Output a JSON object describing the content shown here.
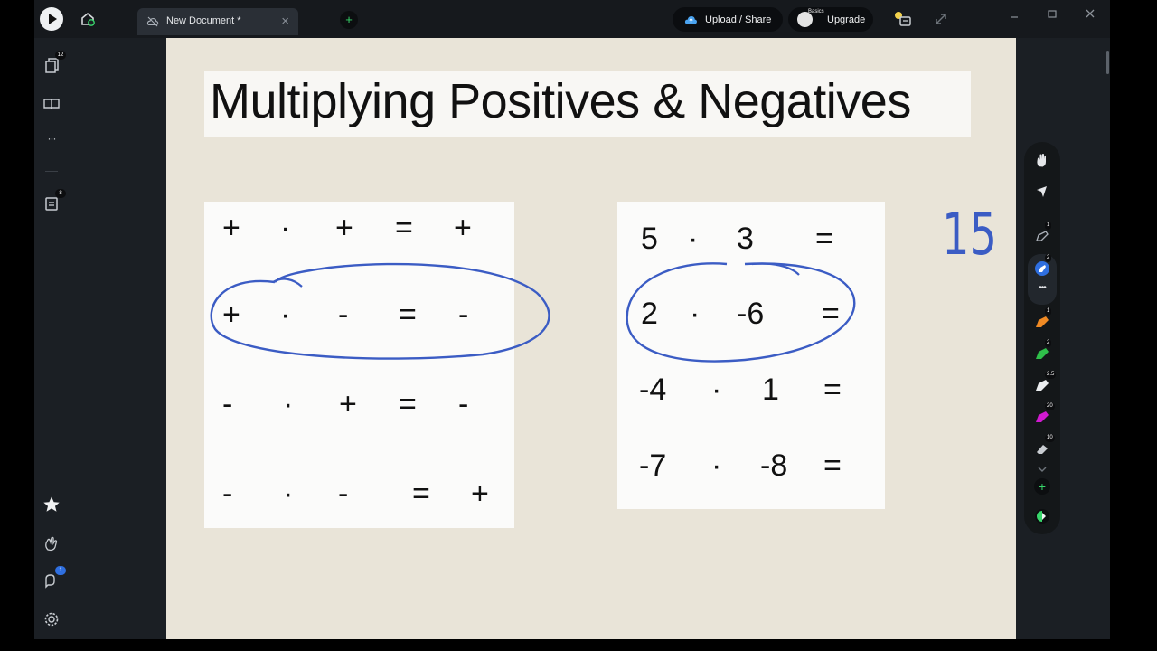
{
  "tab": {
    "title": "New Document *",
    "close_glyph": "×"
  },
  "new_tab_glyph": "+",
  "upload": {
    "label": "Upload / Share"
  },
  "upgrade": {
    "badge": "Basics",
    "label": "Upgrade"
  },
  "sidebar": {
    "pages_badge": "12",
    "more_glyph": "···",
    "notes_badge": "8",
    "help_badge": "1"
  },
  "canvas": {
    "title": "Multiplying Positives & Negatives",
    "sign_rules": [
      [
        "+",
        "·",
        "+",
        "=",
        "+"
      ],
      [
        "+",
        "·",
        "-",
        "=",
        "-"
      ],
      [
        "-",
        "·",
        "+",
        "=",
        "-"
      ],
      [
        "-",
        "·",
        "-",
        "=",
        "+"
      ]
    ],
    "problems": [
      [
        "5",
        "·",
        "3",
        "="
      ],
      [
        "2",
        "·",
        "-6",
        "="
      ],
      [
        "-4",
        "·",
        "1",
        "="
      ],
      [
        "-7",
        "·",
        "-8",
        "="
      ]
    ],
    "handwritten_answer": "15",
    "ink_color": "#3b5cc4"
  },
  "toolbar": {
    "badges": [
      "1",
      "2",
      "1",
      "2",
      "2.5",
      "20",
      "10"
    ],
    "more_glyph": "•••",
    "add_glyph": "+"
  }
}
